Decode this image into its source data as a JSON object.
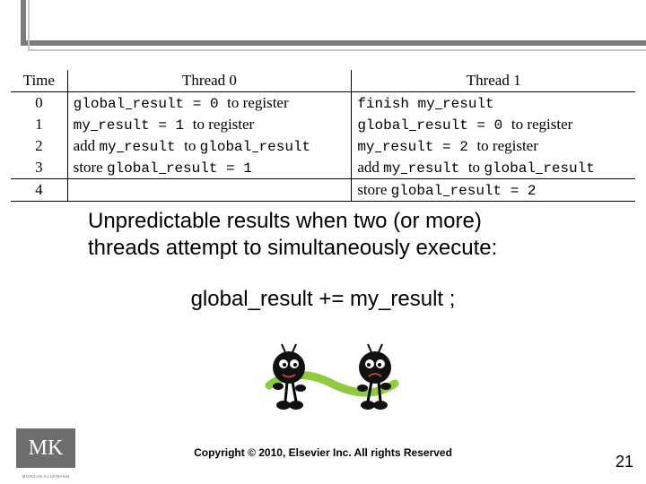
{
  "table": {
    "headers": {
      "time": "Time",
      "t0": "Thread 0",
      "t1": "Thread 1"
    },
    "rows": [
      {
        "time": "0",
        "t0_a": "global",
        "t0_b": "result",
        "t0_c": " = 0 ",
        "t0_d": "to register",
        "t1_a": "finish ",
        "t1_b": "my",
        "t1_c": "result",
        "t1_d": ""
      },
      {
        "time": "1",
        "t0_a": "my",
        "t0_b": "result",
        "t0_c": " = 1 ",
        "t0_d": "to register",
        "t1_a": "global",
        "t1_b": "result",
        "t1_c": " = 0 ",
        "t1_d": "to register"
      },
      {
        "time": "2",
        "t0_a": "add ",
        "t0_b": "my",
        "t0_c": "result ",
        "t0_d": "to ",
        "t0_e": "global",
        "t0_f": "result",
        "t1_a": "my",
        "t1_b": "result",
        "t1_c": " = 2 ",
        "t1_d": "to register"
      },
      {
        "time": "3",
        "t0_a": "store ",
        "t0_b": "global",
        "t0_c": "result",
        "t0_d": " = 1",
        "t1_a": "add ",
        "t1_b": "my",
        "t1_c": "result ",
        "t1_d": "to ",
        "t1_e": "global",
        "t1_f": "result"
      },
      {
        "time": "4",
        "t0_a": "",
        "t1_a": "store ",
        "t1_b": "global",
        "t1_c": "result",
        "t1_d": " = 2"
      }
    ]
  },
  "caption": {
    "line1": "Unpredictable results when two (or more)",
    "line2": "threads attempt to simultaneously execute:"
  },
  "code_line": "global_result += my_result ;",
  "footer": {
    "copyright": "Copyright © 2010, Elsevier Inc. All rights Reserved",
    "page": "21",
    "logo_letters": "MK",
    "logo_sub": "MORGAN KAUFMANN"
  }
}
